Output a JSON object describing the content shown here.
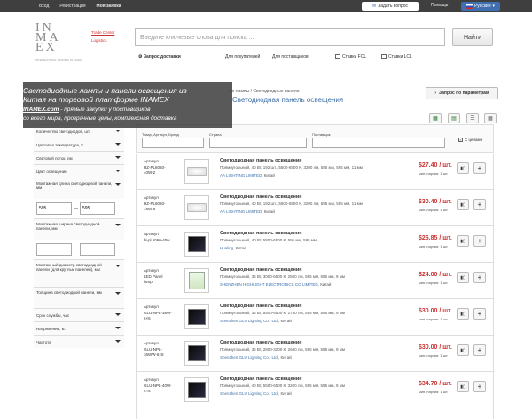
{
  "topbar": {
    "links": [
      "Вход",
      "Регистрация",
      "Моя заявка"
    ],
    "ask_label": "Задать вопрос",
    "help_label": "Помощь",
    "lang_label": "Русский"
  },
  "logo": {
    "text": "IN MA EX",
    "sub": "INTERNATIONAL TRADING IN CHINA"
  },
  "header_links": {
    "trade_center": "Trade Center",
    "logistics": "Logistics"
  },
  "search": {
    "placeholder": "Введите ключевые слова для поиска ...",
    "button": "Найти"
  },
  "subnav": {
    "delivery": "Запрос доставки",
    "buyers": "Для покупателей",
    "suppliers": "Для поставщиков",
    "fcl": "Ставки FCL",
    "lcl": "Ставки LCL"
  },
  "overlay": {
    "line1": "Светодиодные лампы и панели освещения из",
    "line2": "Китая на торговой платформе INAMEX",
    "line3_site": "INAMEX.com",
    "line3_rest": " - прямые закупки у поставщиков",
    "line4": "со всего мира, прозрачные цены, комплексная доставка"
  },
  "breadcrumb": "ые лампы / Светодиодные панели",
  "page_title": "Светодиодная панель освещения",
  "request_params_button": "Запрос по параметрам",
  "filters": [
    "Количество светодиодов, шт.",
    "Цветовая температура, К",
    "Световой поток, лм",
    "Цвет освещения",
    "Монтажная длина светодиодной панели, мм",
    "Монтажная ширина светодиодной панели, мм",
    "Монтажный диаметр светодиодной панели (для круглых панелей), мм",
    "Толщина светодиодной панели, мм",
    "Срок службы, час",
    "Напряжение, В.",
    "Частота"
  ],
  "filter_inputs": {
    "length_from": "595",
    "length_to": "595",
    "dash": "—"
  },
  "table_header": {
    "product_label": "Товар, Артикул, Бренд",
    "country_label": "Страна",
    "supplier_label": "Поставщик",
    "with_prices": "С ценами",
    "page_number": "30"
  },
  "products": [
    {
      "article": [
        "Артикул",
        "HZ-PL6060-",
        "40W-2"
      ],
      "name": "Светодиодная панель освещения",
      "spec": "Прямоугольный, 40 Вт, 192 шт., 5500-6500 К, 3200 лм, 595 мм, 595 мм, 11 мм",
      "supplier": "AA LIGHTING LIMITED",
      "country": ", Китай",
      "price": "$27.40 / шт.",
      "min": "мин. партия: 1 шт."
    },
    {
      "article": [
        "Артикул",
        "HZ-PL6060-",
        "40W-3"
      ],
      "name": "Светодиодная панель освещения",
      "spec": "Прямоугольный, 40 Вт, 192 шт., 5500-6500 К, 3200 лм, 595 мм, 595 мм, 11 мм",
      "supplier": "AA LIGHTING LIMITED",
      "country": ", Китай",
      "price": "$30.40 / шт.",
      "min": "мин. партия: 1 шт."
    },
    {
      "article": [
        "Артикул",
        "hl-pl 6060-40w"
      ],
      "name": "Светодиодная панель освещения",
      "spec": "Прямоугольный, 40 Вт, 5800-6500 К, 595 мм, 595 мм",
      "supplier": "Hualing",
      "country": ", Китай",
      "price": "$26.85 / шт.",
      "min": "мин. партия: 1 шт."
    },
    {
      "article": [
        "Артикул",
        "LED Panel",
        "lamp"
      ],
      "name": "Светодиодная панель освещения",
      "spec": "Прямоугольный, 36 Вт, 3000-6500 К, 2500 лм, 595 мм, 595 мм, 9 мм",
      "supplier": "SHENZHEN HIGHLIGHT ELECTRONICS CO LIMITED",
      "country": ", Китай",
      "price": "$24.00 / шт.",
      "min": "мин. партия: 1 шт."
    },
    {
      "article": [
        "Артикул",
        "GLU-NPL-36W-",
        "6×6"
      ],
      "name": "Светодиодная панель освещения",
      "spec": "Прямоугольный, 36 Вт, 5500-6500 К, 2780 лм, 595 мм, 595 мм, 9 мм",
      "supplier": "Shenzhen GLU Lighting Co., Ltd.",
      "country": ", Китай",
      "price": "$30.00 / шт.",
      "min": "мин. партия: 1 шт."
    },
    {
      "article": [
        "Артикул",
        "GLU-NPL-",
        "36WW-6×6"
      ],
      "name": "Светодиодная панель освещения",
      "spec": "Прямоугольный, 36 Вт, 2800-3200 К, 2680 лм, 595 мм, 595 мм, 9 мм",
      "supplier": "Shenzhen GLU Lighting Co., Ltd.",
      "country": ", Китай",
      "price": "$30.00 / шт.",
      "min": "мин. партия: 1 шт."
    },
    {
      "article": [
        "Артикул",
        "GLU-NPL-40W-",
        "6×6"
      ],
      "name": "Светодиодная панель освещения",
      "spec": "Прямоугольный, 40 Вт, 5500-6500 К, 3200 лм, 595 мм, 595 мм, 9 мм",
      "supplier": "Shenzhen GLU Lighting Co., Ltd.",
      "country": ", Китай",
      "price": "$34.70 / шт.",
      "min": "мин. партия: 1 шт."
    }
  ],
  "icons": {
    "chart": "bar-chart-icon",
    "add": "plus-icon"
  }
}
